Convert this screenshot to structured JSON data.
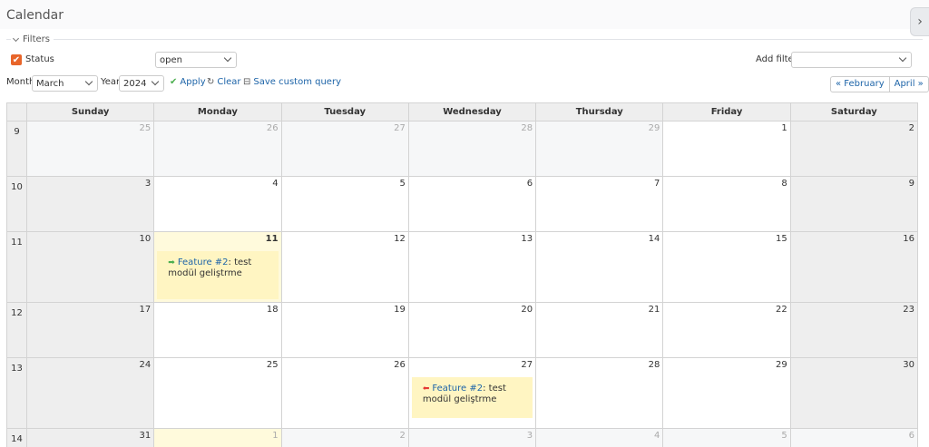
{
  "page": {
    "title": "Calendar"
  },
  "filters": {
    "legend": "Filters",
    "status_label": "Status",
    "status_value": "open",
    "add_filter_label": "Add filter",
    "add_filter_value": ""
  },
  "controls": {
    "month_label": "Month",
    "month_value": "March",
    "year_label": "Year",
    "year_value": "2024",
    "apply": "Apply",
    "clear": "Clear",
    "save_query": "Save custom query",
    "prev": "« February",
    "next": "April »"
  },
  "calendar": {
    "days": [
      "Sunday",
      "Monday",
      "Tuesday",
      "Wednesday",
      "Thursday",
      "Friday",
      "Saturday"
    ],
    "weeks": [
      {
        "week": "9",
        "dates": [
          "25",
          "26",
          "27",
          "28",
          "29",
          "1",
          "2"
        ]
      },
      {
        "week": "10",
        "dates": [
          "3",
          "4",
          "5",
          "6",
          "7",
          "8",
          "9"
        ]
      },
      {
        "week": "11",
        "dates": [
          "10",
          "11",
          "12",
          "13",
          "14",
          "15",
          "16"
        ]
      },
      {
        "week": "12",
        "dates": [
          "17",
          "18",
          "19",
          "20",
          "21",
          "22",
          "23"
        ]
      },
      {
        "week": "13",
        "dates": [
          "24",
          "25",
          "26",
          "27",
          "28",
          "29",
          "30"
        ]
      },
      {
        "week": "14",
        "dates": [
          "31",
          "1",
          "2",
          "3",
          "4",
          "5",
          "6"
        ]
      }
    ],
    "events": [
      {
        "link": "Feature #2",
        "text": ": test modül geliştrme",
        "icon": "arrow-right-icon"
      },
      {
        "link": "Feature #2",
        "text": ": test modül geliştrme",
        "icon": "arrow-left-icon"
      }
    ],
    "colors": {
      "start_icon": "#4caf50",
      "end_icon": "#e53935",
      "today": "#fffadc",
      "event": "#fff5c2"
    }
  }
}
